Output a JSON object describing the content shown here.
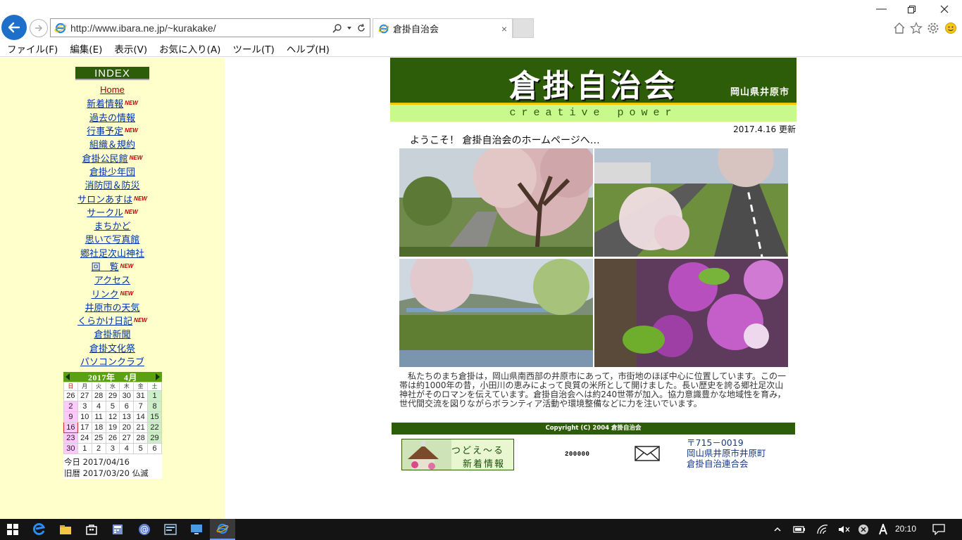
{
  "browser": {
    "url": "http://www.ibara.ne.jp/~kurakake/",
    "tab_title": "倉掛自治会",
    "tab_close": "×",
    "menu": [
      "ファイル(F)",
      "編集(E)",
      "表示(V)",
      "お気に入り(A)",
      "ツール(T)",
      "ヘルプ(H)"
    ]
  },
  "sidebar": {
    "index_label": "INDEX",
    "new_badge": "NEW",
    "nav": [
      {
        "label": "Home",
        "new": false
      },
      {
        "label": "新着情報",
        "new": true
      },
      {
        "label": "過去の情報",
        "new": false
      },
      {
        "label": "行事予定",
        "new": true
      },
      {
        "label": "組織＆規約",
        "new": false
      },
      {
        "label": "倉掛公民館",
        "new": true
      },
      {
        "label": "倉掛少年団",
        "new": false
      },
      {
        "label": "消防団＆防災",
        "new": false
      },
      {
        "label": "サロンあすは",
        "new": true
      },
      {
        "label": "サークル",
        "new": true
      },
      {
        "label": "まちかど",
        "new": false
      },
      {
        "label": "思いで写真館",
        "new": false
      },
      {
        "label": "郷社足次山神社",
        "new": false
      },
      {
        "label": "回　覧",
        "new": true
      },
      {
        "label": "アクセス",
        "new": false
      },
      {
        "label": "リンク",
        "new": true
      },
      {
        "label": "井原市の天気",
        "new": false
      },
      {
        "label": "くらかけ日記",
        "new": true
      },
      {
        "label": "倉掛新聞",
        "new": false
      },
      {
        "label": "倉掛文化祭",
        "new": false
      },
      {
        "label": "パソコンクラブ",
        "new": false
      }
    ]
  },
  "calendar": {
    "title": "2017年　4月",
    "weekdays": [
      "日",
      "月",
      "火",
      "水",
      "木",
      "金",
      "土"
    ],
    "weeks": [
      [
        "26",
        "27",
        "28",
        "29",
        "30",
        "31",
        "1"
      ],
      [
        "2",
        "3",
        "4",
        "5",
        "6",
        "7",
        "8"
      ],
      [
        "9",
        "10",
        "11",
        "12",
        "13",
        "14",
        "15"
      ],
      [
        "16",
        "17",
        "18",
        "19",
        "20",
        "21",
        "22"
      ],
      [
        "23",
        "24",
        "25",
        "26",
        "27",
        "28",
        "29"
      ],
      [
        "30",
        "1",
        "2",
        "3",
        "4",
        "5",
        "6"
      ]
    ],
    "today_line": "今日 2017/04/16",
    "lunar_line": "旧暦 2017/03/20 仏滅"
  },
  "header": {
    "title": "倉掛自治会",
    "prefecture": "岡山県井原市",
    "tagline": "creative power"
  },
  "main": {
    "updated": "2017.4.16 更新",
    "welcome": "ようこそ！ 倉掛自治会のホームページへ…",
    "intro": "　私たちのまち倉掛は，岡山県南西部の井原市にあって，市街地のほぼ中心に位置しています。この一帯は約1000年の昔，小田川の恵みによって良質の米所として開けました。長い歴史を誇る郷社足次山神社がそのロマンを伝えています。倉掛自治会へは約240世帯が加入。協力意識豊かな地域性を育み，世代間交流を図りながらボランティア活動や環境整備などに力を注いでいます。",
    "copyright": "Copyright (C) 2004 倉掛自治会"
  },
  "footer": {
    "tsudoe_line1": "つどえ～る",
    "tsudoe_line2": "新着情報",
    "counter": "200000",
    "postal": "〒715－0019",
    "address": "岡山県井原市井原町",
    "org": "倉掛自治連合会"
  },
  "taskbar": {
    "time": "20:10"
  },
  "colors": {
    "banner_green": "#2e5d09",
    "sidebar_bg": "#ffffcc",
    "tagline_bg": "#c8f98c",
    "link_blue": "#0033aa",
    "browser_accent": "#1e6fc9"
  },
  "icons": [
    "back-arrow-icon",
    "forward-arrow-icon",
    "ie-icon",
    "search-icon",
    "refresh-icon",
    "home-icon",
    "star-icon",
    "gear-icon",
    "smiley-icon",
    "mail-icon",
    "windows-start-icon"
  ]
}
